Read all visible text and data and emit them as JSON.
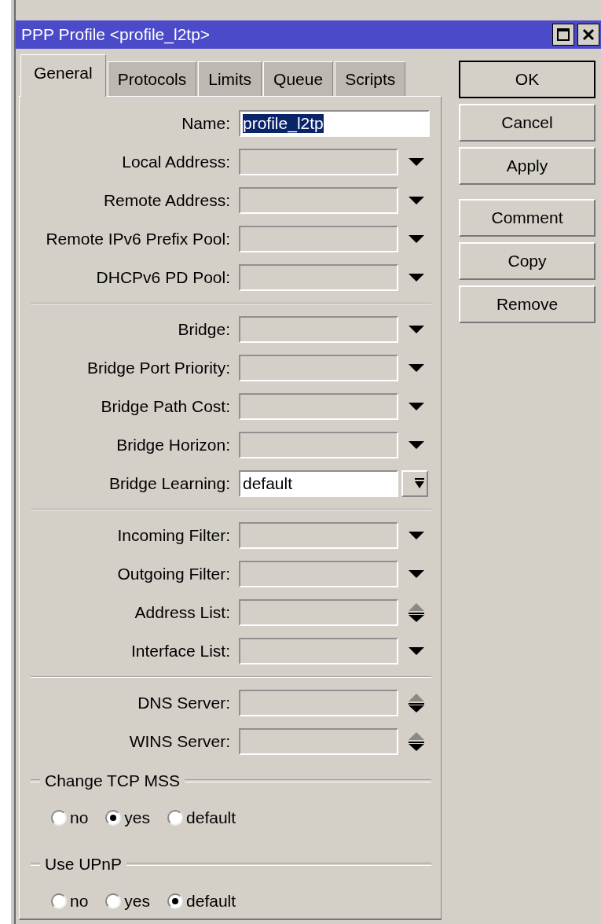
{
  "window": {
    "title": "PPP Profile <profile_l2tp>"
  },
  "tabs": [
    {
      "label": "General",
      "selected": true
    },
    {
      "label": "Protocols",
      "selected": false
    },
    {
      "label": "Limits",
      "selected": false
    },
    {
      "label": "Queue",
      "selected": false
    },
    {
      "label": "Scripts",
      "selected": false
    }
  ],
  "sections": [
    [
      {
        "label": "Name:",
        "kind": "text",
        "value": "profile_l2tp",
        "highlighted": true
      },
      {
        "label": "Local Address:",
        "kind": "dropdown"
      },
      {
        "label": "Remote Address:",
        "kind": "dropdown"
      },
      {
        "label": "Remote IPv6 Prefix Pool:",
        "kind": "dropdown"
      },
      {
        "label": "DHCPv6 PD Pool:",
        "kind": "dropdown"
      }
    ],
    [
      {
        "label": "Bridge:",
        "kind": "dropdown"
      },
      {
        "label": "Bridge Port Priority:",
        "kind": "dropdown"
      },
      {
        "label": "Bridge Path Cost:",
        "kind": "dropdown"
      },
      {
        "label": "Bridge Horizon:",
        "kind": "dropdown"
      },
      {
        "label": "Bridge Learning:",
        "kind": "combo",
        "value": "default"
      }
    ],
    [
      {
        "label": "Incoming Filter:",
        "kind": "dropdown"
      },
      {
        "label": "Outgoing Filter:",
        "kind": "dropdown"
      },
      {
        "label": "Address List:",
        "kind": "updown"
      },
      {
        "label": "Interface List:",
        "kind": "dropdown"
      }
    ],
    [
      {
        "label": "DNS Server:",
        "kind": "updown"
      },
      {
        "label": "WINS Server:",
        "kind": "updown"
      }
    ]
  ],
  "radio_groups": [
    {
      "title": "Change TCP MSS",
      "options": [
        {
          "label": "no",
          "selected": false
        },
        {
          "label": "yes",
          "selected": true
        },
        {
          "label": "default",
          "selected": false
        }
      ]
    },
    {
      "title": "Use UPnP",
      "options": [
        {
          "label": "no",
          "selected": false
        },
        {
          "label": "yes",
          "selected": false
        },
        {
          "label": "default",
          "selected": true
        }
      ]
    }
  ],
  "buttons": [
    {
      "label": "OK",
      "default": true
    },
    {
      "label": "Cancel",
      "default": false
    },
    {
      "label": "Apply",
      "default": false
    },
    {
      "label": "Comment",
      "default": false
    },
    {
      "label": "Copy",
      "default": false
    },
    {
      "label": "Remove",
      "default": false
    }
  ]
}
